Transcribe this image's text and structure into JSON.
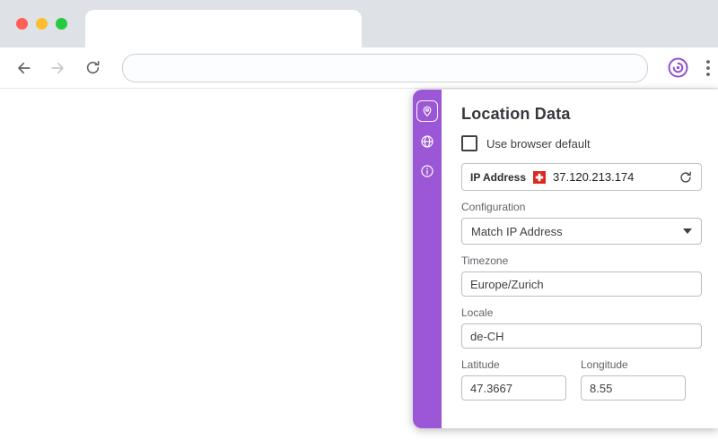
{
  "colors": {
    "accent": "#9b57d6",
    "flag_red": "#da291c"
  },
  "browser": {
    "address_value": "",
    "icons": {
      "back": "back-arrow-icon",
      "forward": "forward-arrow-icon",
      "reload": "reload-icon",
      "extension": "vytal-fingerprint-logo",
      "menu": "kebab-menu-icon"
    }
  },
  "panel": {
    "title": "Location Data",
    "use_browser_default_label": "Use browser default",
    "rail_icons": {
      "location": "location-pin-icon",
      "globe": "globe-icon",
      "info": "info-icon"
    },
    "ip": {
      "label": "IP Address",
      "value": "37.120.213.174",
      "flag": "swiss-flag"
    },
    "configuration": {
      "label": "Configuration",
      "selected": "Match IP Address"
    },
    "timezone": {
      "label": "Timezone",
      "value": "Europe/Zurich"
    },
    "locale": {
      "label": "Locale",
      "value": "de-CH"
    },
    "latitude": {
      "label": "Latitude",
      "value": "47.3667"
    },
    "longitude": {
      "label": "Longitude",
      "value": "8.55"
    }
  }
}
